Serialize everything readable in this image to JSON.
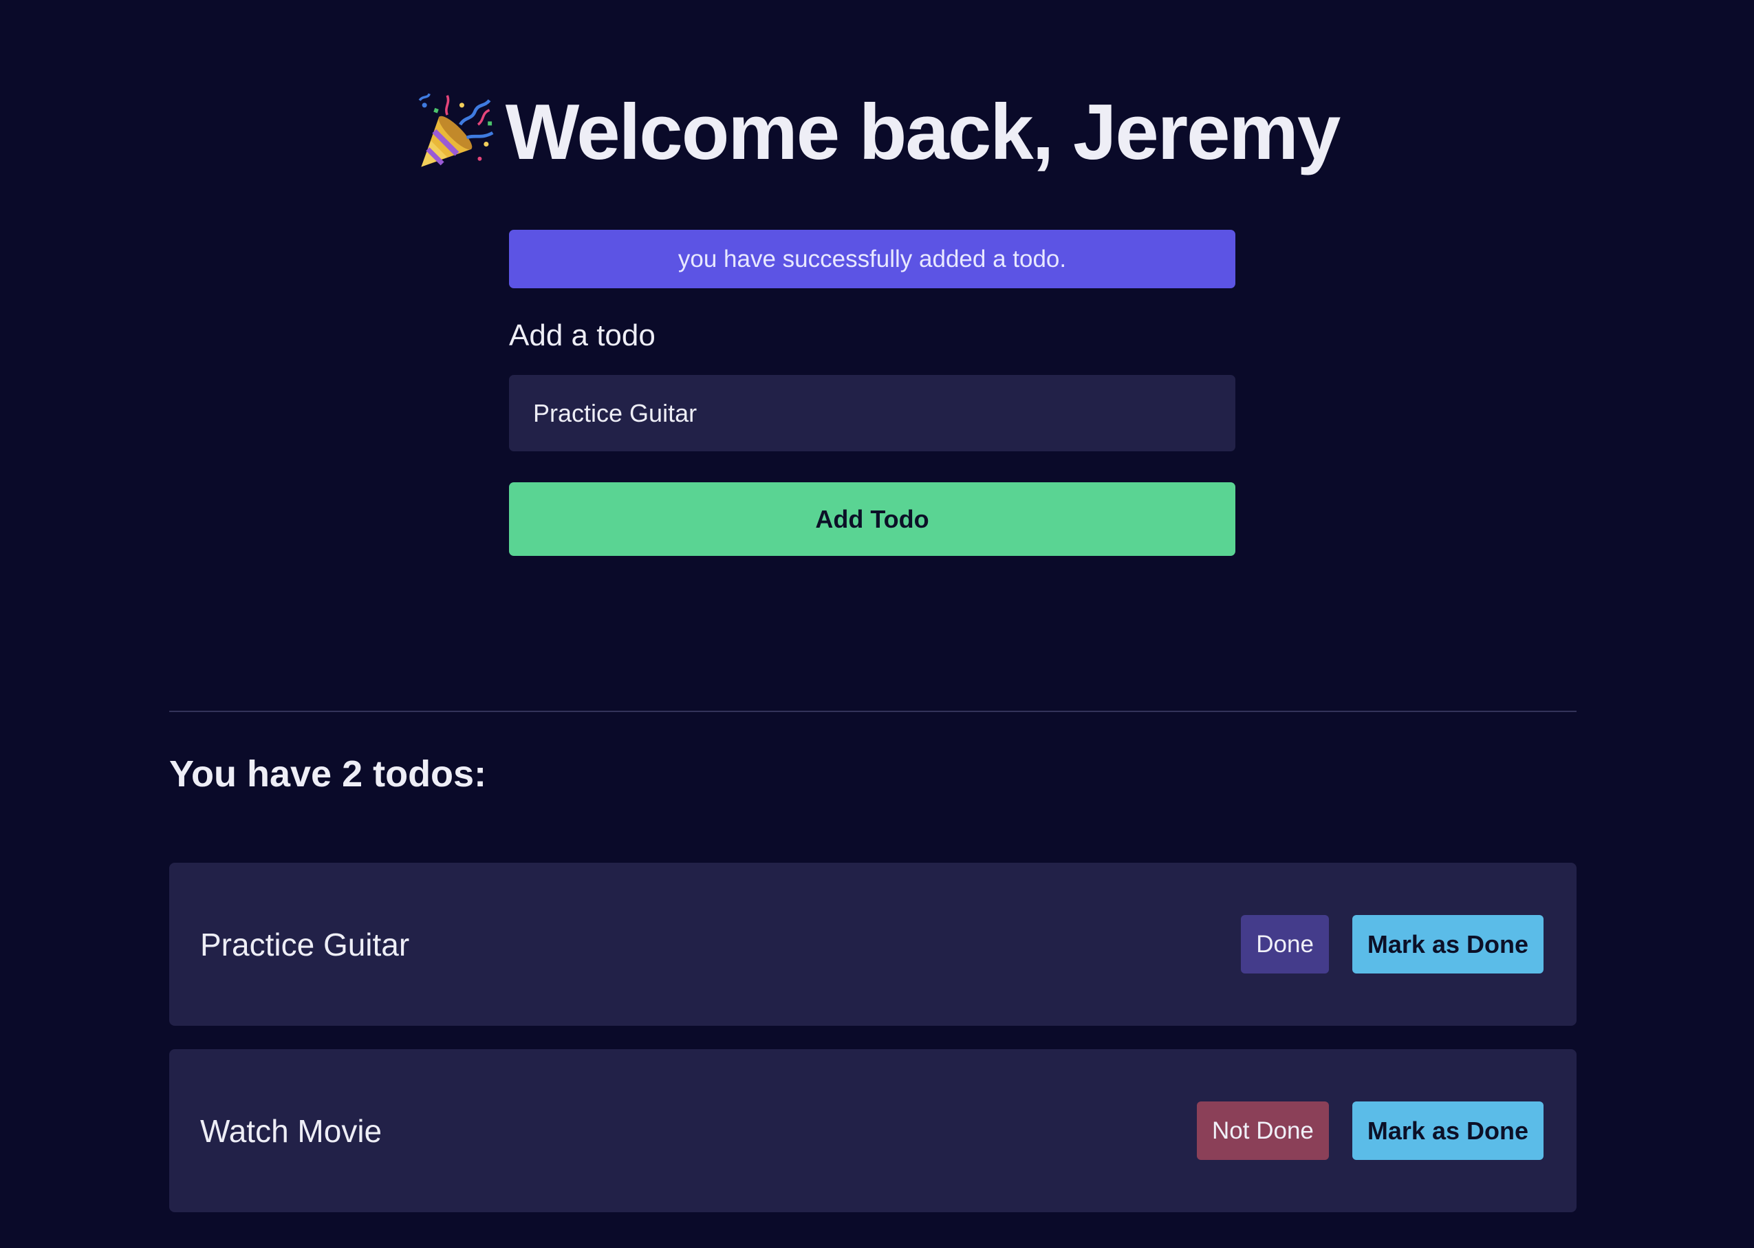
{
  "header": {
    "icon": "party-popper-icon",
    "title": "Welcome back, Jeremy"
  },
  "flash": {
    "message": "you have successfully added a todo."
  },
  "form": {
    "label": "Add a todo",
    "input_value": "Practice Guitar",
    "submit_label": "Add Todo"
  },
  "list": {
    "heading": "You have 2 todos:",
    "items": [
      {
        "text": "Practice Guitar",
        "status": "Done",
        "action": "Mark as Done"
      },
      {
        "text": "Watch Movie",
        "status": "Not Done",
        "action": "Mark as Done"
      }
    ]
  },
  "colors": {
    "background": "#0a0a29",
    "flash": "#5c54e4",
    "card": "#222148",
    "add_button": "#5ad493",
    "mark_button": "#5bbce8",
    "status_done": "#443c8b",
    "status_not_done": "#8b4058"
  }
}
